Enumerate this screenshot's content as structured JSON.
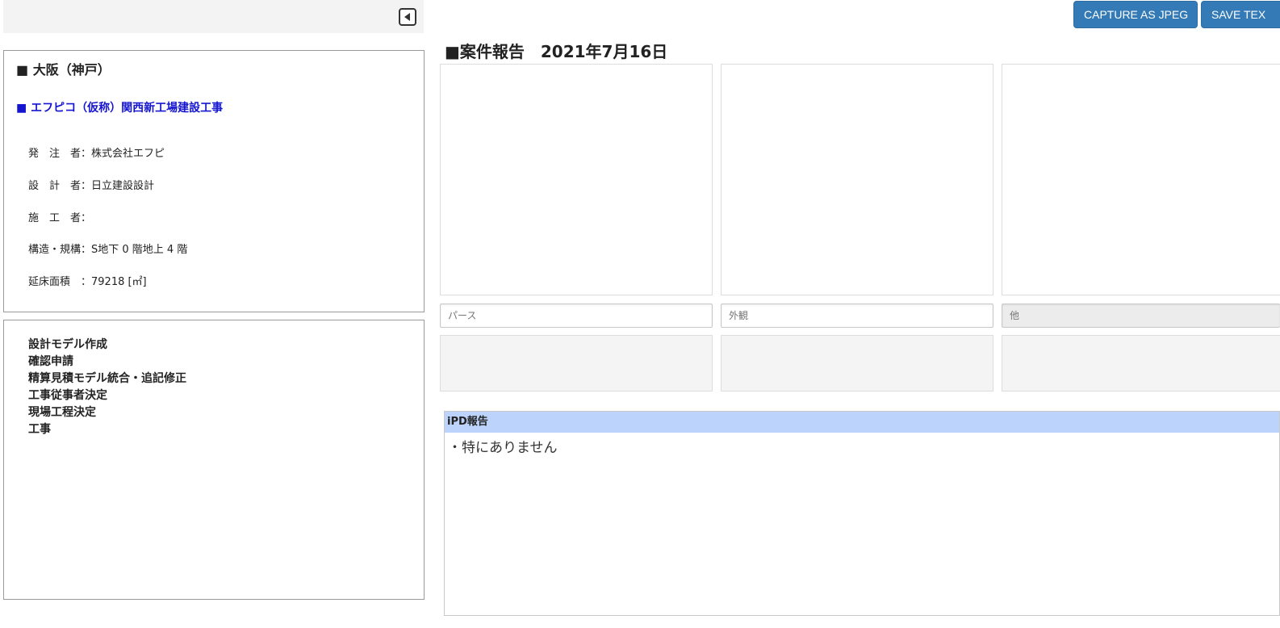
{
  "toolbar": {
    "capture_label": "CAPTURE AS JPEG",
    "save_label": "SAVE TEX"
  },
  "info": {
    "area": "■ 大阪（神戸）",
    "project": "■ エフピコ（仮称）関西新工場建設工事",
    "rows": [
      "発　注　者：株式会社エフピ",
      "設　計　者：日立建設設計",
      "施　工　者：",
      "構造・規構：S地下 0 階地上 4 階",
      "延床面積　：79218 [㎡]"
    ]
  },
  "steps": [
    "設計モデル作成",
    "確認申請",
    "精算見積モデル統合・追記修正",
    "工事従事者決定",
    "現場工程決定",
    "工事"
  ],
  "report": {
    "title": "■案件報告　2021年7月16日"
  },
  "captions": {
    "placeholder_1": "パース",
    "placeholder_2": "外観",
    "placeholder_3": "他"
  },
  "ipd": {
    "header": "iPD報告",
    "body": "・特にありません"
  },
  "colors": {
    "button_bg": "#337ab7",
    "ipd_header_bg": "#bcd3fb",
    "project_title": "#1515d0"
  }
}
